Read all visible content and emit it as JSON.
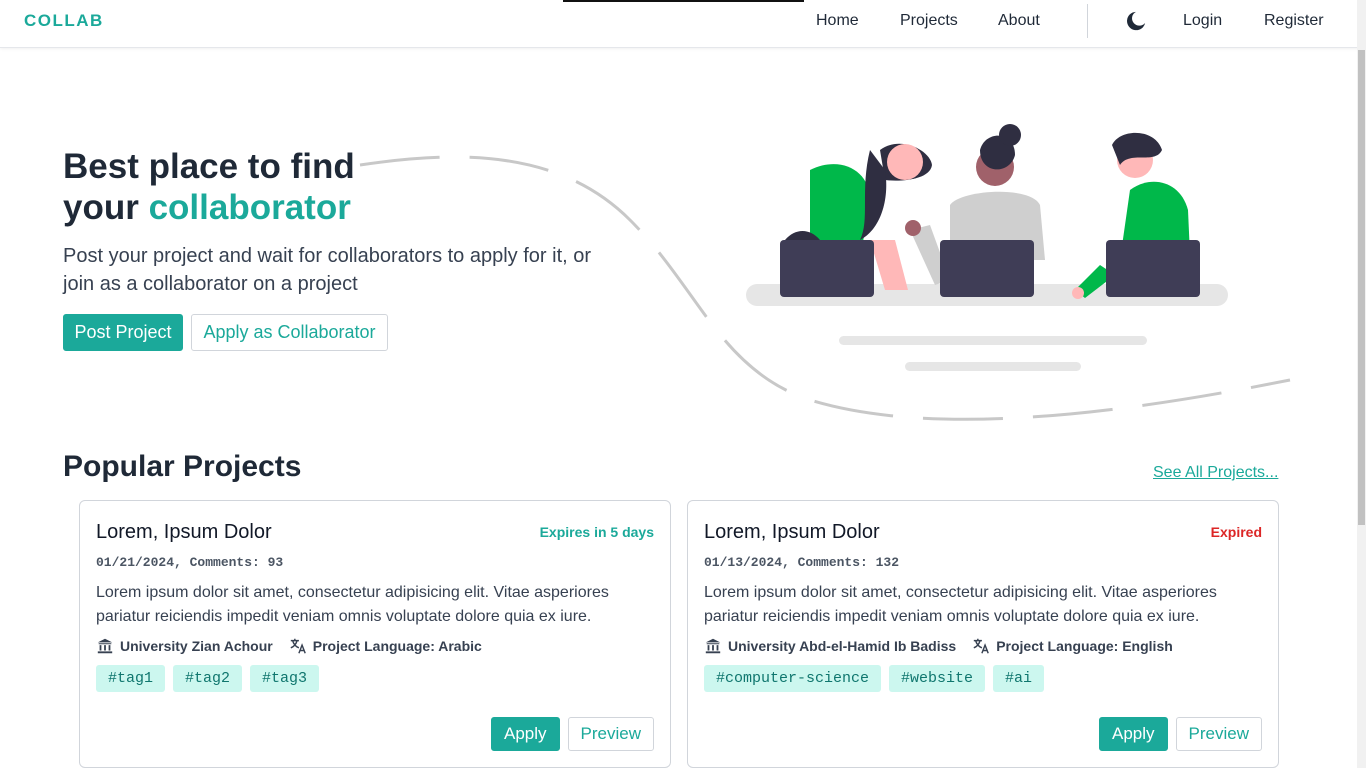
{
  "nav": {
    "brand": "COLLAB",
    "links": [
      "Home",
      "Projects",
      "About"
    ],
    "login": "Login",
    "register": "Register",
    "theme_icon": "moon-icon"
  },
  "hero": {
    "title_line1": "Best place to find",
    "title_line2_prefix": "your ",
    "title_line2_accent": "collaborator",
    "subtitle": "Post your project and wait for collaborators to apply for it, or join as a collaborator on a project",
    "post_button": "Post Project",
    "apply_button": "Apply as Collaborator"
  },
  "section": {
    "title": "Popular Projects",
    "see_all": "See All Projects..."
  },
  "projects": [
    {
      "title": "Lorem, Ipsum Dolor",
      "status": "Expires in 5 days",
      "status_color": "#1ba99a",
      "meta": "01/21/2024, Comments: 93",
      "description": "Lorem ipsum dolor sit amet, consectetur adipisicing elit. Vitae asperiores pariatur reiciendis impedit veniam omnis voluptate dolore quia ex iure.",
      "university": "University Zian Achour",
      "language": "Project Language: Arabic",
      "tags": [
        "#tag1",
        "#tag2",
        "#tag3"
      ],
      "apply": "Apply",
      "preview": "Preview"
    },
    {
      "title": "Lorem, Ipsum Dolor",
      "status": "Expired",
      "status_color": "#dc2626",
      "meta": "01/13/2024, Comments: 132",
      "description": "Lorem ipsum dolor sit amet, consectetur adipisicing elit. Vitae asperiores pariatur reiciendis impedit veniam omnis voluptate dolore quia ex iure.",
      "university": "University Abd-el-Hamid Ib Badiss",
      "language": "Project Language: English",
      "tags": [
        "#computer-science",
        "#website",
        "#ai"
      ],
      "apply": "Apply",
      "preview": "Preview"
    }
  ],
  "colors": {
    "accent": "#1ba99a",
    "illustration_green": "#00b84a",
    "laptop": "#3f3d56"
  }
}
